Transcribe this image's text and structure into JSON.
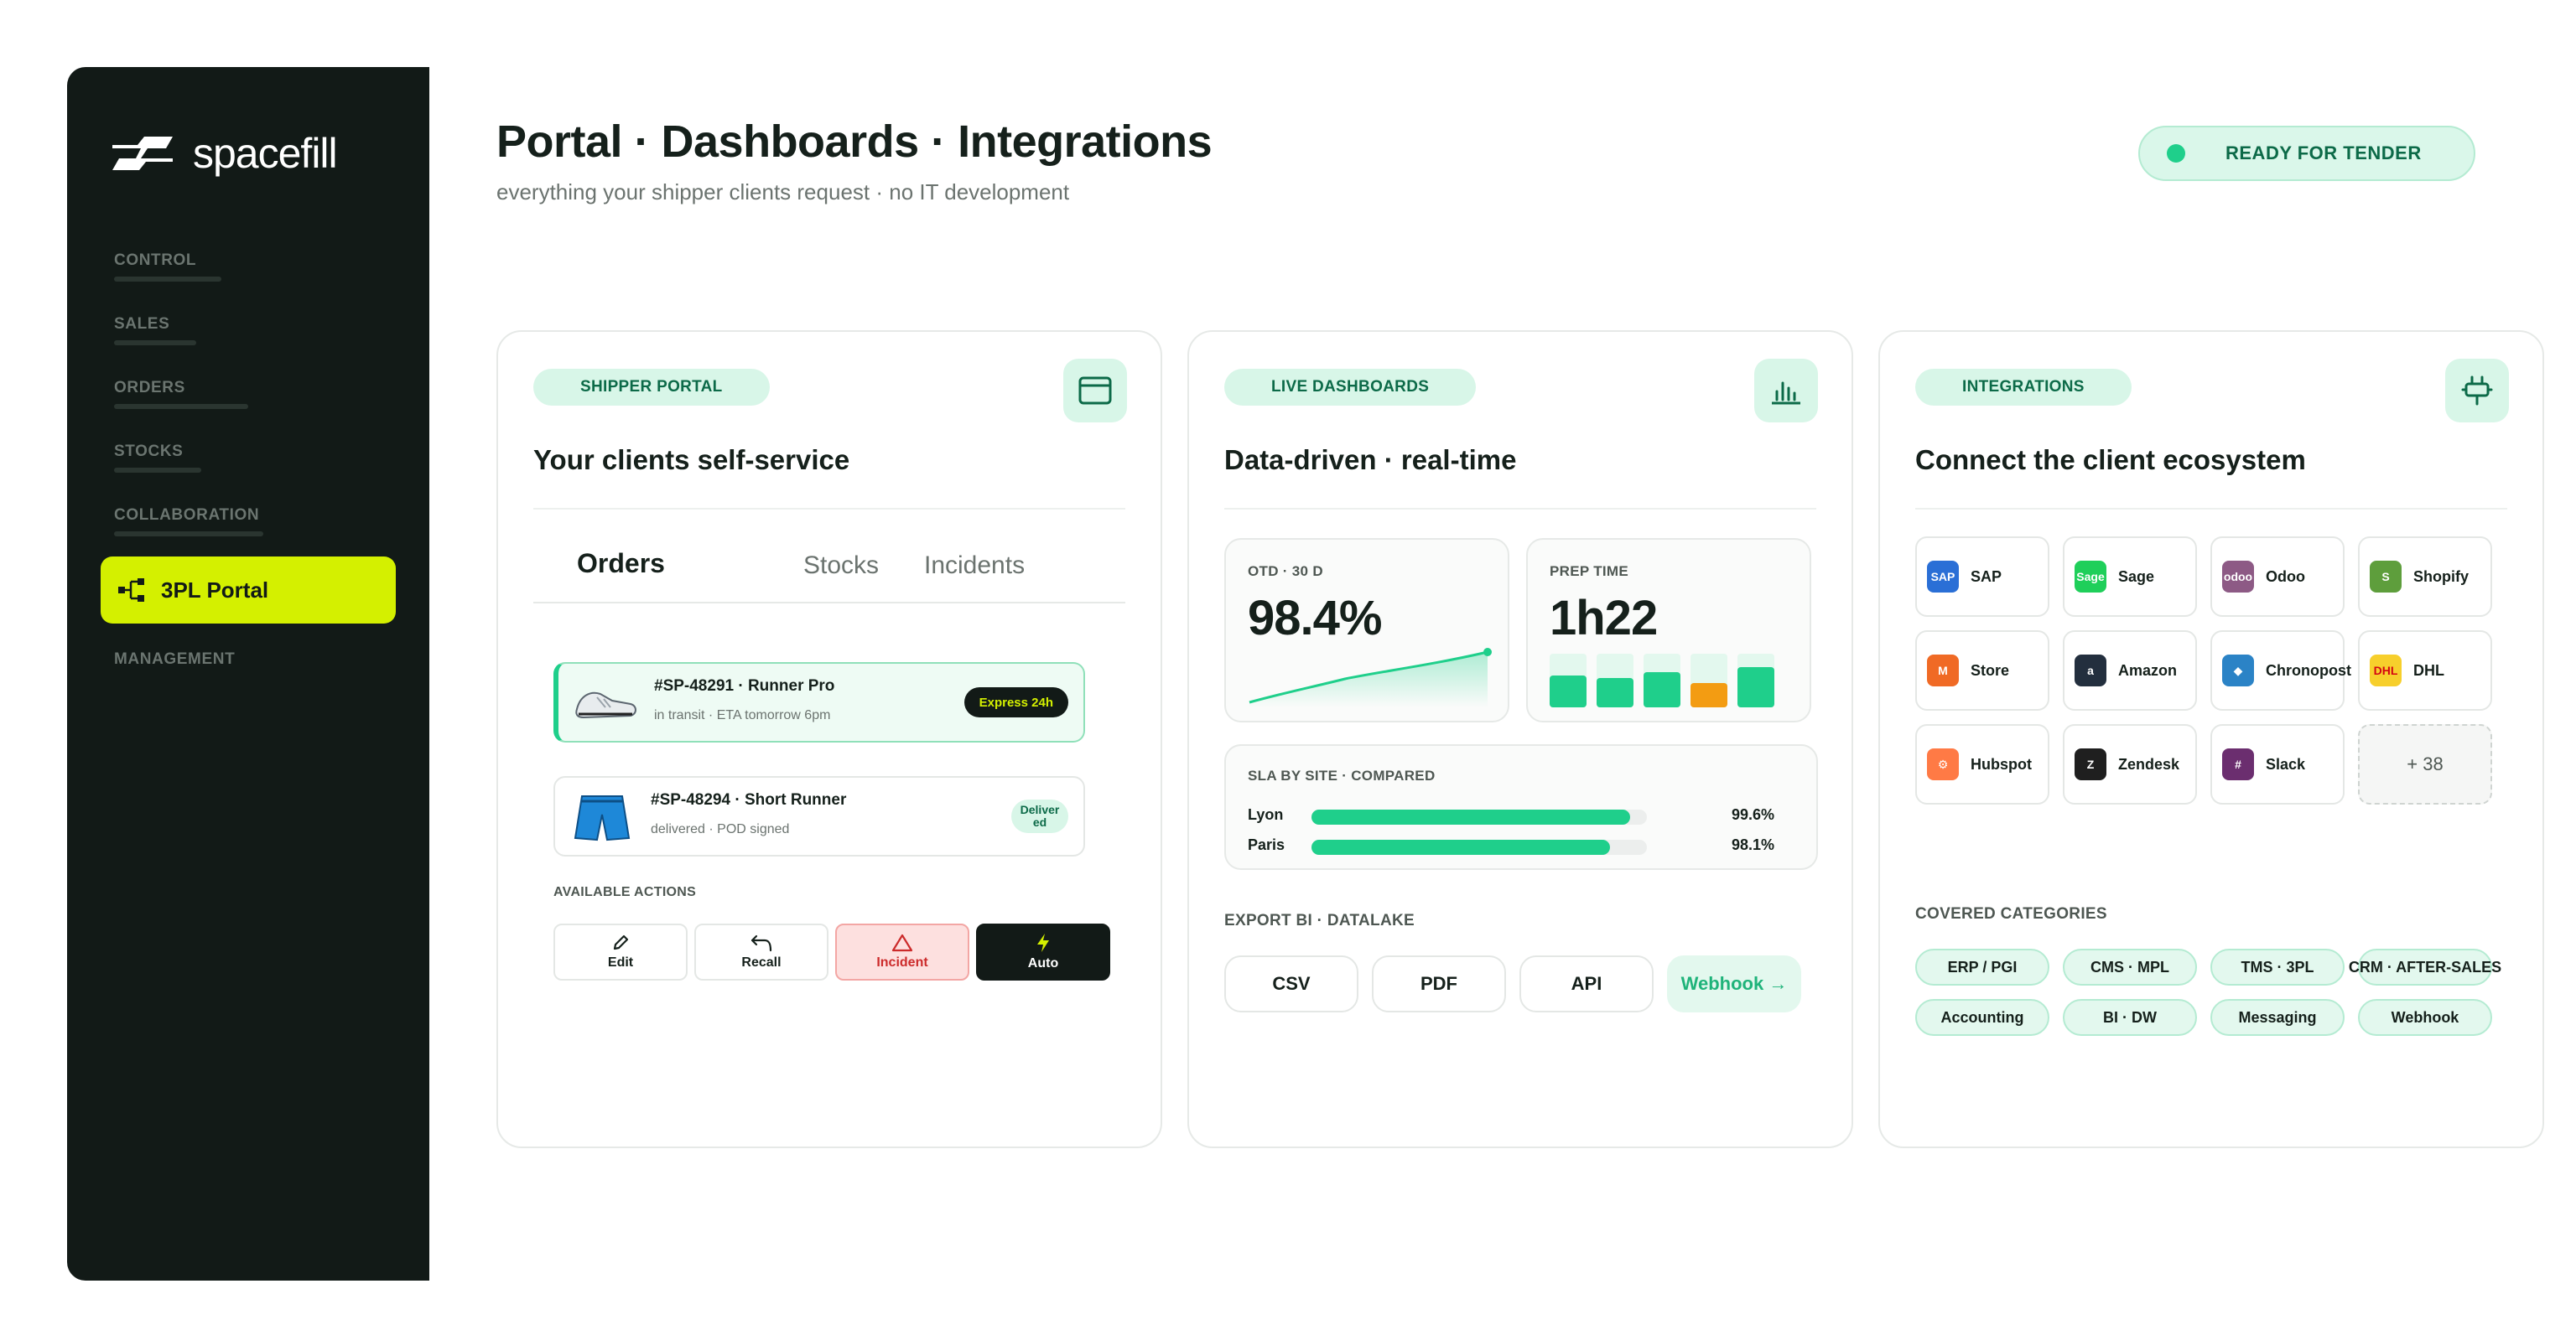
{
  "brand": {
    "name": "spacefill"
  },
  "sidebar": {
    "items": [
      {
        "label": "CONTROL"
      },
      {
        "label": "SALES"
      },
      {
        "label": "ORDERS"
      },
      {
        "label": "STOCKS"
      },
      {
        "label": "COLLABORATION"
      },
      {
        "label": "3PL Portal",
        "active": true
      },
      {
        "label": "MANAGEMENT"
      }
    ]
  },
  "header": {
    "title": "Portal · Dashboards · Integrations",
    "subtitle": "everything your shipper clients request · no IT development",
    "status": "READY FOR TENDER"
  },
  "colors": {
    "accent": "#1fcf8b",
    "lime": "#d4f000",
    "dark": "#121a17",
    "incident": "#cc2b2b",
    "warn": "#f39c12"
  },
  "portal": {
    "pill": "SHIPPER PORTAL",
    "icon": "browser-window-icon",
    "title": "Your clients self-service",
    "tabs": [
      "Orders",
      "Stocks",
      "Incidents"
    ],
    "orders": [
      {
        "id": "#SP-48291 · Runner Pro",
        "status": "in transit · ETA tomorrow 6pm",
        "badge": "Express 24h"
      },
      {
        "id": "#SP-48294 · Short Runner",
        "status": "delivered · POD signed",
        "badge": "Delivered"
      }
    ],
    "actions_label": "AVAILABLE ACTIONS",
    "actions": [
      {
        "label": "Edit",
        "icon": "pencil-icon"
      },
      {
        "label": "Recall",
        "icon": "undo-arrow-icon"
      },
      {
        "label": "Incident",
        "icon": "warning-triangle-icon"
      },
      {
        "label": "Auto",
        "icon": "lightning-icon"
      }
    ]
  },
  "dashboards": {
    "pill": "LIVE DASHBOARDS",
    "icon": "bar-chart-icon",
    "title": "Data-driven · real-time",
    "otd": {
      "label": "OTD · 30 D",
      "value": "98.4%"
    },
    "prep": {
      "label": "PREP TIME",
      "value": "1h22",
      "bars": [
        0.6,
        0.55,
        0.65,
        0.45,
        0.75
      ]
    },
    "sla": {
      "label": "SLA BY SITE · COMPARED",
      "rows": [
        {
          "site": "Lyon",
          "pct": "99.6%",
          "fill": 0.95
        },
        {
          "site": "Paris",
          "pct": "98.1%",
          "fill": 0.89
        }
      ]
    },
    "export_label": "EXPORT BI · DATALAKE",
    "exports": [
      "CSV",
      "PDF",
      "API",
      "Webhook →"
    ]
  },
  "integrations": {
    "pill": "INTEGRATIONS",
    "icon": "plug-icon",
    "title": "Connect the client ecosystem",
    "items": [
      {
        "name": "SAP",
        "logo": "SAP",
        "color": "#2a6fd6"
      },
      {
        "name": "Sage",
        "logo": "Sage",
        "color": "#1fcf5a"
      },
      {
        "name": "Odoo",
        "logo": "odoo",
        "color": "#8d5a85"
      },
      {
        "name": "Shopify",
        "logo": "S",
        "color": "#5e9e3c"
      },
      {
        "name": "Store",
        "logo": "M",
        "color": "#f06a25"
      },
      {
        "name": "Amazon",
        "logo": "a",
        "color": "#232f3e"
      },
      {
        "name": "Chronopost",
        "logo": "◆",
        "color": "#2b83c6"
      },
      {
        "name": "DHL",
        "logo": "DHL",
        "color": "#f7cf2c"
      },
      {
        "name": "Hubspot",
        "logo": "⚙",
        "color": "#ff7a45"
      },
      {
        "name": "Zendesk",
        "logo": "Z",
        "color": "#1f1f1f"
      },
      {
        "name": "Slack",
        "logo": "#",
        "color": "#6b2e6f"
      }
    ],
    "more": "+ 38",
    "categories_label": "COVERED CATEGORIES",
    "categories": [
      "ERP / PGI",
      "CMS · MPL",
      "TMS · 3PL",
      "CRM · AFTER-SALES",
      "Accounting",
      "BI · DW",
      "Messaging",
      "Webhook"
    ]
  }
}
